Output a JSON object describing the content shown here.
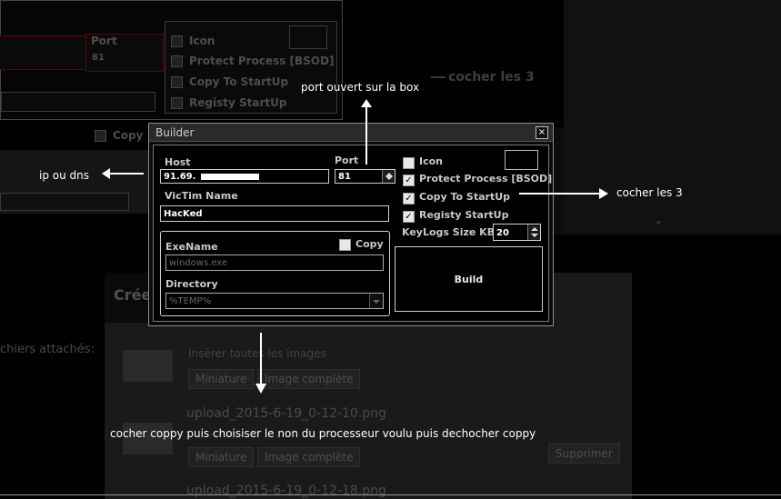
{
  "background": {
    "ghost_port_label": "Port",
    "ghost_port_value": "81",
    "ghost_checks": [
      "Icon",
      "Protect Process [BSOD]",
      "Copy To StartUp",
      "Registy StartUp"
    ],
    "ghost_copy": "Copy",
    "ghost_annotation": "cocher les 3",
    "forum_heading": "Crée",
    "files_attached": "chiers attachés:",
    "insert_text": "Insérer toutes les images",
    "file1": "upload_2015-6-19_0-12-10.png",
    "file2": "upload_2015-6-19_0-12-18.png",
    "btn_thumbnail": "Miniature",
    "btn_full_image": "Image complète",
    "btn_delete": "Supprimer"
  },
  "builder": {
    "title": "Builder",
    "close_glyph": "×",
    "host_label": "Host",
    "host_value": "91.69.",
    "port_label": "Port",
    "port_value": "81",
    "victim_label": "VicTim Name",
    "victim_value": "HacKed",
    "exename_label": "ExeName",
    "exename_value": "windows.exe",
    "copy_label": "Copy",
    "directory_label": "Directory",
    "directory_value": "%TEMP%",
    "icon_label": "Icon",
    "protect_label": "Protect Process [BSOD]",
    "startup_label": "Copy To StartUp",
    "registry_label": "Registy StartUp",
    "keylogs_label": "KeyLogs Size KB",
    "keylogs_value": "20",
    "build_label": "Build",
    "checks": {
      "icon": false,
      "protect": true,
      "startup": true,
      "registry": true,
      "copy": false
    },
    "check_glyph": "✓"
  },
  "annotations": {
    "port_note": "port ouvert sur la box",
    "ip_note": "ip ou dns",
    "check_note": "cocher les 3",
    "copy_note": "cocher coppy puis choisiser le non du processeur voulu puis dechocher coppy"
  }
}
